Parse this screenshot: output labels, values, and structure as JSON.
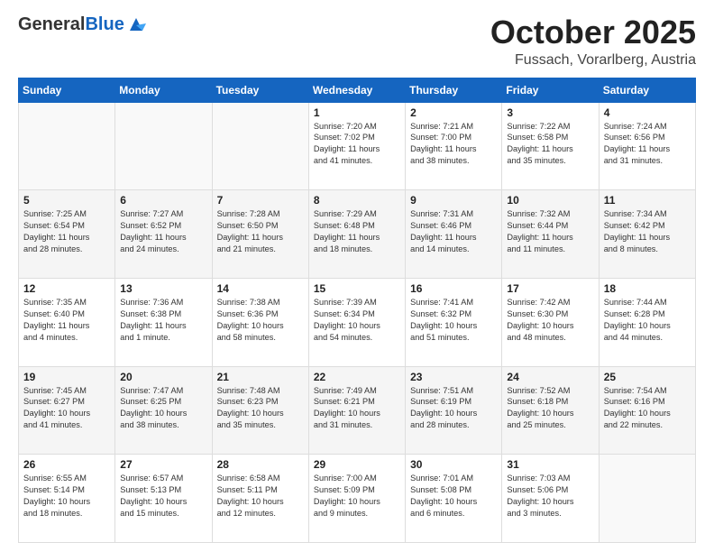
{
  "header": {
    "logo_general": "General",
    "logo_blue": "Blue",
    "title": "October 2025",
    "subtitle": "Fussach, Vorarlberg, Austria"
  },
  "days_of_week": [
    "Sunday",
    "Monday",
    "Tuesday",
    "Wednesday",
    "Thursday",
    "Friday",
    "Saturday"
  ],
  "weeks": [
    [
      {
        "day": "",
        "info": ""
      },
      {
        "day": "",
        "info": ""
      },
      {
        "day": "",
        "info": ""
      },
      {
        "day": "1",
        "info": "Sunrise: 7:20 AM\nSunset: 7:02 PM\nDaylight: 11 hours\nand 41 minutes."
      },
      {
        "day": "2",
        "info": "Sunrise: 7:21 AM\nSunset: 7:00 PM\nDaylight: 11 hours\nand 38 minutes."
      },
      {
        "day": "3",
        "info": "Sunrise: 7:22 AM\nSunset: 6:58 PM\nDaylight: 11 hours\nand 35 minutes."
      },
      {
        "day": "4",
        "info": "Sunrise: 7:24 AM\nSunset: 6:56 PM\nDaylight: 11 hours\nand 31 minutes."
      }
    ],
    [
      {
        "day": "5",
        "info": "Sunrise: 7:25 AM\nSunset: 6:54 PM\nDaylight: 11 hours\nand 28 minutes."
      },
      {
        "day": "6",
        "info": "Sunrise: 7:27 AM\nSunset: 6:52 PM\nDaylight: 11 hours\nand 24 minutes."
      },
      {
        "day": "7",
        "info": "Sunrise: 7:28 AM\nSunset: 6:50 PM\nDaylight: 11 hours\nand 21 minutes."
      },
      {
        "day": "8",
        "info": "Sunrise: 7:29 AM\nSunset: 6:48 PM\nDaylight: 11 hours\nand 18 minutes."
      },
      {
        "day": "9",
        "info": "Sunrise: 7:31 AM\nSunset: 6:46 PM\nDaylight: 11 hours\nand 14 minutes."
      },
      {
        "day": "10",
        "info": "Sunrise: 7:32 AM\nSunset: 6:44 PM\nDaylight: 11 hours\nand 11 minutes."
      },
      {
        "day": "11",
        "info": "Sunrise: 7:34 AM\nSunset: 6:42 PM\nDaylight: 11 hours\nand 8 minutes."
      }
    ],
    [
      {
        "day": "12",
        "info": "Sunrise: 7:35 AM\nSunset: 6:40 PM\nDaylight: 11 hours\nand 4 minutes."
      },
      {
        "day": "13",
        "info": "Sunrise: 7:36 AM\nSunset: 6:38 PM\nDaylight: 11 hours\nand 1 minute."
      },
      {
        "day": "14",
        "info": "Sunrise: 7:38 AM\nSunset: 6:36 PM\nDaylight: 10 hours\nand 58 minutes."
      },
      {
        "day": "15",
        "info": "Sunrise: 7:39 AM\nSunset: 6:34 PM\nDaylight: 10 hours\nand 54 minutes."
      },
      {
        "day": "16",
        "info": "Sunrise: 7:41 AM\nSunset: 6:32 PM\nDaylight: 10 hours\nand 51 minutes."
      },
      {
        "day": "17",
        "info": "Sunrise: 7:42 AM\nSunset: 6:30 PM\nDaylight: 10 hours\nand 48 minutes."
      },
      {
        "day": "18",
        "info": "Sunrise: 7:44 AM\nSunset: 6:28 PM\nDaylight: 10 hours\nand 44 minutes."
      }
    ],
    [
      {
        "day": "19",
        "info": "Sunrise: 7:45 AM\nSunset: 6:27 PM\nDaylight: 10 hours\nand 41 minutes."
      },
      {
        "day": "20",
        "info": "Sunrise: 7:47 AM\nSunset: 6:25 PM\nDaylight: 10 hours\nand 38 minutes."
      },
      {
        "day": "21",
        "info": "Sunrise: 7:48 AM\nSunset: 6:23 PM\nDaylight: 10 hours\nand 35 minutes."
      },
      {
        "day": "22",
        "info": "Sunrise: 7:49 AM\nSunset: 6:21 PM\nDaylight: 10 hours\nand 31 minutes."
      },
      {
        "day": "23",
        "info": "Sunrise: 7:51 AM\nSunset: 6:19 PM\nDaylight: 10 hours\nand 28 minutes."
      },
      {
        "day": "24",
        "info": "Sunrise: 7:52 AM\nSunset: 6:18 PM\nDaylight: 10 hours\nand 25 minutes."
      },
      {
        "day": "25",
        "info": "Sunrise: 7:54 AM\nSunset: 6:16 PM\nDaylight: 10 hours\nand 22 minutes."
      }
    ],
    [
      {
        "day": "26",
        "info": "Sunrise: 6:55 AM\nSunset: 5:14 PM\nDaylight: 10 hours\nand 18 minutes."
      },
      {
        "day": "27",
        "info": "Sunrise: 6:57 AM\nSunset: 5:13 PM\nDaylight: 10 hours\nand 15 minutes."
      },
      {
        "day": "28",
        "info": "Sunrise: 6:58 AM\nSunset: 5:11 PM\nDaylight: 10 hours\nand 12 minutes."
      },
      {
        "day": "29",
        "info": "Sunrise: 7:00 AM\nSunset: 5:09 PM\nDaylight: 10 hours\nand 9 minutes."
      },
      {
        "day": "30",
        "info": "Sunrise: 7:01 AM\nSunset: 5:08 PM\nDaylight: 10 hours\nand 6 minutes."
      },
      {
        "day": "31",
        "info": "Sunrise: 7:03 AM\nSunset: 5:06 PM\nDaylight: 10 hours\nand 3 minutes."
      },
      {
        "day": "",
        "info": ""
      }
    ]
  ]
}
